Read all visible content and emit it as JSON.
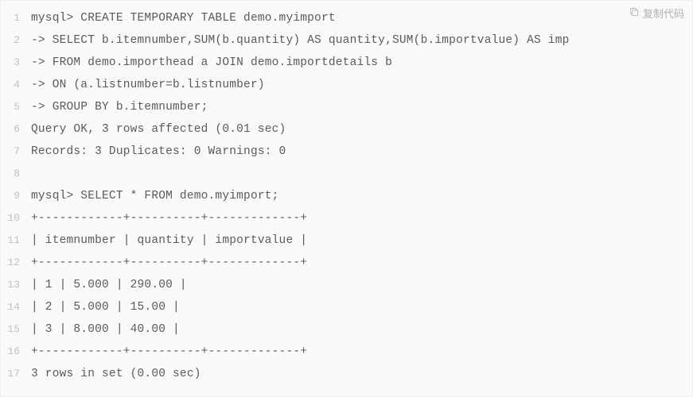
{
  "copy_button_label": "复制代码",
  "lines": [
    {
      "n": "1",
      "text": "mysql> CREATE TEMPORARY TABLE demo.myimport"
    },
    {
      "n": "2",
      "text": "-> SELECT b.itemnumber,SUM(b.quantity) AS quantity,SUM(b.importvalue) AS imp"
    },
    {
      "n": "3",
      "text": "-> FROM demo.importhead a JOIN demo.importdetails b"
    },
    {
      "n": "4",
      "text": "-> ON (a.listnumber=b.listnumber)"
    },
    {
      "n": "5",
      "text": "-> GROUP BY b.itemnumber;"
    },
    {
      "n": "6",
      "text": "Query OK, 3 rows affected (0.01 sec)"
    },
    {
      "n": "7",
      "text": "Records: 3 Duplicates: 0 Warnings: 0"
    },
    {
      "n": "8",
      "text": ""
    },
    {
      "n": "9",
      "text": "mysql> SELECT * FROM demo.myimport;"
    },
    {
      "n": "10",
      "text": "+------------+----------+-------------+"
    },
    {
      "n": "11",
      "text": "| itemnumber | quantity | importvalue |"
    },
    {
      "n": "12",
      "text": "+------------+----------+-------------+"
    },
    {
      "n": "13",
      "text": "| 1 | 5.000 | 290.00 |"
    },
    {
      "n": "14",
      "text": "| 2 | 5.000 | 15.00 |"
    },
    {
      "n": "15",
      "text": "| 3 | 8.000 | 40.00 |"
    },
    {
      "n": "16",
      "text": "+------------+----------+-------------+"
    },
    {
      "n": "17",
      "text": "3 rows in set (0.00 sec)"
    }
  ]
}
